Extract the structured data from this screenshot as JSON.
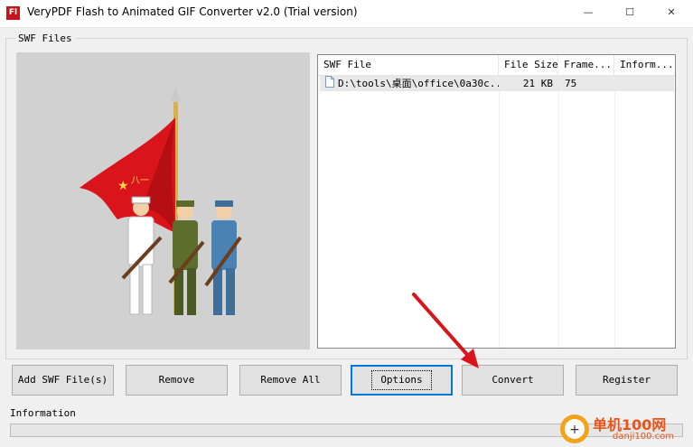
{
  "window": {
    "title": "VeryPDF Flash to Animated GIF Converter v2.0 (Trial version)",
    "icon_text": "Fl",
    "controls": {
      "minimize": "—",
      "maximize": "☐",
      "close": "✕"
    }
  },
  "swf_files": {
    "group_label": "SWF Files",
    "columns": [
      "SWF File",
      "File Size",
      "Frame...",
      "Inform..."
    ],
    "rows": [
      {
        "file": "D:\\tools\\桌面\\office\\0a30c...",
        "size": "21 KB",
        "frames": "75",
        "info": ""
      }
    ]
  },
  "buttons": {
    "add": "Add SWF File(s)",
    "remove": "Remove",
    "remove_all": "Remove All",
    "options": "Options",
    "convert": "Convert",
    "register": "Register"
  },
  "information": {
    "label": "Information",
    "progress": 0
  },
  "watermark": {
    "brand": "单机100网",
    "url": "danji100.com"
  },
  "colors": {
    "accent": "#0078d7",
    "arrow": "#d9141b",
    "flag": "#d9141b"
  }
}
